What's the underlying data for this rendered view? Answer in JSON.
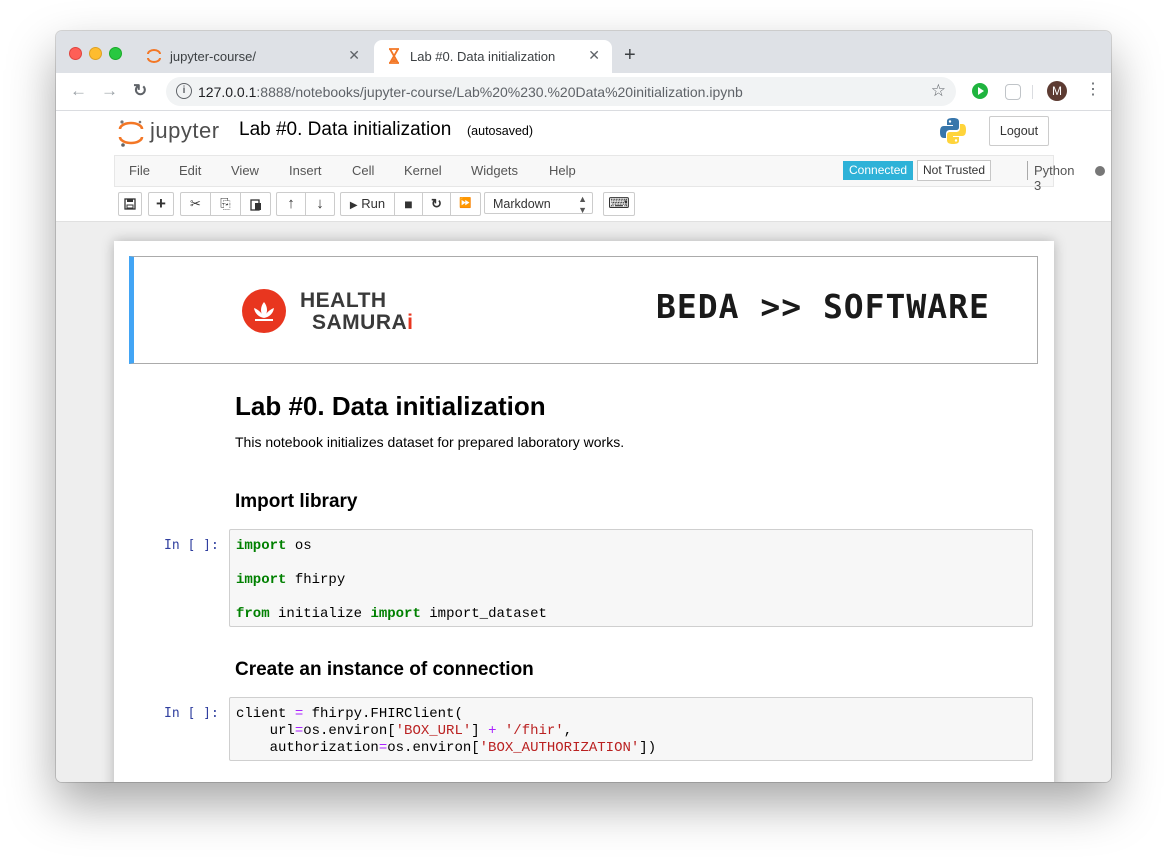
{
  "browser": {
    "tabs": [
      {
        "title": "jupyter-course/",
        "active": false
      },
      {
        "title": "Lab #0. Data initialization",
        "active": true
      }
    ],
    "close_glyph": "✕",
    "new_tab_glyph": "+",
    "url_host": "127.0.0.1",
    "url_rest": ":8888/notebooks/jupyter-course/Lab%20%230.%20Data%20initialization.ipynb",
    "avatar_initial": "M",
    "nav": {
      "back": "←",
      "forward": "→",
      "reload": "↻"
    },
    "star_glyph": "☆",
    "menu_glyph": "⋮",
    "info_glyph": "i"
  },
  "jupyter": {
    "logo_text": "jupyter",
    "notebook_title": "Lab #0. Data initialization",
    "autosave_status": "(autosaved)",
    "logout_label": "Logout",
    "menu": [
      "File",
      "Edit",
      "View",
      "Insert",
      "Cell",
      "Kernel",
      "Widgets",
      "Help"
    ],
    "connection_status": "Connected",
    "trust_status": "Not Trusted",
    "kernel_name": "Python 3",
    "toolbar": {
      "run_label": "Run",
      "cell_type": "Markdown"
    },
    "toolbar_icons": {
      "save": "💾",
      "add": "+",
      "cut": "✂",
      "copy": "⎘",
      "paste": "📋",
      "up": "↑",
      "down": "↓",
      "run": "▶",
      "stop": "■",
      "restart": "↻",
      "fastforward": "⏩",
      "keyboard": "⌨"
    },
    "colors": {
      "connected_badge": "#2eb2d8",
      "banner_accent": "#42a5f5",
      "prompt": "#303f9f"
    }
  },
  "notebook": {
    "banner": {
      "health": "HEALTH",
      "samurai": "SAMURA",
      "samurai_dot": "i",
      "beda": "BEDA >> SOFTWARE"
    },
    "title": "Lab #0. Data initialization",
    "intro": "This notebook initializes dataset for prepared laboratory works.",
    "section_import": "Import library",
    "section_connection": "Create an instance of connection",
    "prompt": "In [ ]:"
  }
}
